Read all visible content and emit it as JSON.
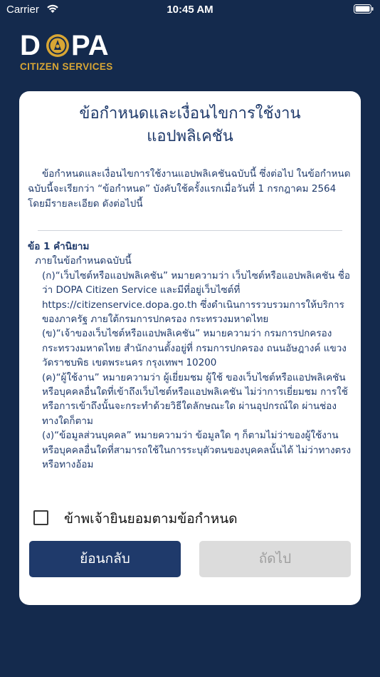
{
  "status_bar": {
    "carrier": "Carrier",
    "time": "10:45 AM"
  },
  "logo": {
    "letter_d": "D",
    "letters_pa": "PA",
    "subtitle": "CITIZEN SERVICES",
    "gold_color": "#d8a634"
  },
  "dialog": {
    "title_line1": "ข้อกำหนดและเงื่อนไขการใช้งาน",
    "title_line2": "แอปพลิเคชัน",
    "intro": "ข้อกำหนดและเงื่อนไขการใช้งานแอปพลิเคชันฉบับนี้ ซึ่งต่อไป ในข้อกำหนดฉบับนี้จะเรียกว่า “ข้อกำหนด” บังคับใช้ครั้งแรกเมื่อวันที่ 1 กรกฎาคม 2564 โดยมีรายละเอียด ดังต่อไปนี้",
    "section1_title": "ข้อ 1 คำนิยาม",
    "section1_lead": "ภายในข้อกำหนดฉบับนี้",
    "items": [
      "(ก)“เว็บไซต์หรือแอปพลิเคชัน” หมายความว่า เว็บไซต์หรือแอปพลิเคชัน ชื่อว่า DOPA Citizen Service และมีที่อยู่เว็บไซต์ที่ https://citizenservice.dopa.go.th ซึ่งดำเนินการรวบรวมการให้บริการของภาครัฐ ภายใต้กรมการปกครอง กระทรวงมหาดไทย",
      "(ข)“เจ้าของเว็บไซต์หรือแอปพลิเคชัน” หมายความว่า กรมการปกครอง กระทรวงมหาดไทย สำนักงานตั้งอยู่ที่ กรมการปกครอง ถนนอัษฎางค์ แขวงวัดราชบพิธ เขตพระนคร กรุงเทพฯ 10200",
      "(ค)“ผู้ใช้งาน” หมายความว่า ผู้เยี่ยมชม ผู้ใช้ ของเว็บไซต์หรือแอปพลิเคชัน หรือบุคคลอื่นใดที่เข้าถึงเว็บไซต์หรือแอปพลิเคชัน ไม่ว่าการเยี่ยมชม การใช้ หรือการเข้าถึงนั้นจะกระทำด้วยวิธีใดลักษณะใด ผ่านอุปกรณ์ใด ผ่านช่องทางใดก็ตาม",
      "(ง)“ข้อมูลส่วนบุคคล” หมายความว่า ข้อมูลใด ๆ ก็ตามไม่ว่าของผู้ใช้งานหรือบุคคลอื่นใดที่สามารถใช้ในการระบุตัวตนของบุคคลนั้นได้ ไม่ว่าทางตรงหรือทางอ้อม"
    ],
    "accept_label": "ข้าพเจ้ายินยอมตามข้อกำหนด",
    "back_label": "ย้อนกลับ",
    "next_label": "ถัดไป"
  },
  "colors": {
    "background": "#142a4d",
    "primary": "#1f3a6b",
    "disabled_button": "#dcdcdc",
    "disabled_text": "#9e9e9e"
  }
}
